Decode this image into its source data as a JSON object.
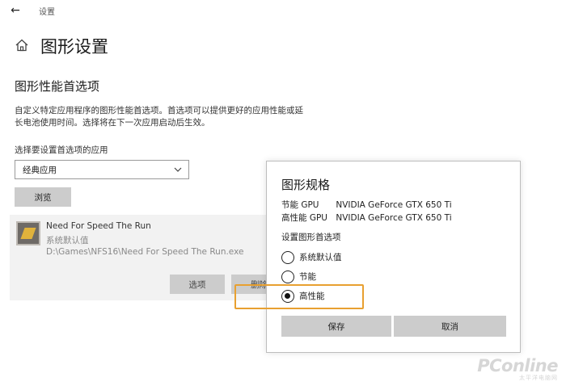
{
  "window": {
    "title": "设置"
  },
  "header": {
    "title": "图形设置"
  },
  "section": {
    "title": "图形性能首选项",
    "description": "自定义特定应用程序的图形性能首选项。首选项可以提供更好的应用性能或延长电池使用时间。选择将在下一次应用启动后生效。",
    "select_label": "选择要设置首选项的应用",
    "select_value": "经典应用",
    "browse_label": "浏览"
  },
  "app": {
    "name": "Need For Speed The Run",
    "preference": "系统默认值",
    "path": "D:\\Games\\NFS16\\Need For Speed The Run.exe",
    "options_label": "选项",
    "remove_label": "删除"
  },
  "dialog": {
    "title": "图形规格",
    "gpus": [
      {
        "label": "节能 GPU",
        "value": "NVIDIA GeForce GTX 650 Ti"
      },
      {
        "label": "高性能 GPU",
        "value": "NVIDIA GeForce GTX 650 Ti"
      }
    ],
    "pref_label": "设置图形首选项",
    "options": [
      {
        "label": "系统默认值",
        "selected": false
      },
      {
        "label": "节能",
        "selected": false
      },
      {
        "label": "高性能",
        "selected": true
      }
    ],
    "save_label": "保存",
    "cancel_label": "取消"
  },
  "watermark": {
    "text": "PConline",
    "sub": "太平洋电脑网"
  },
  "colors": {
    "highlight": "#e8a030",
    "button": "#cccccc"
  }
}
